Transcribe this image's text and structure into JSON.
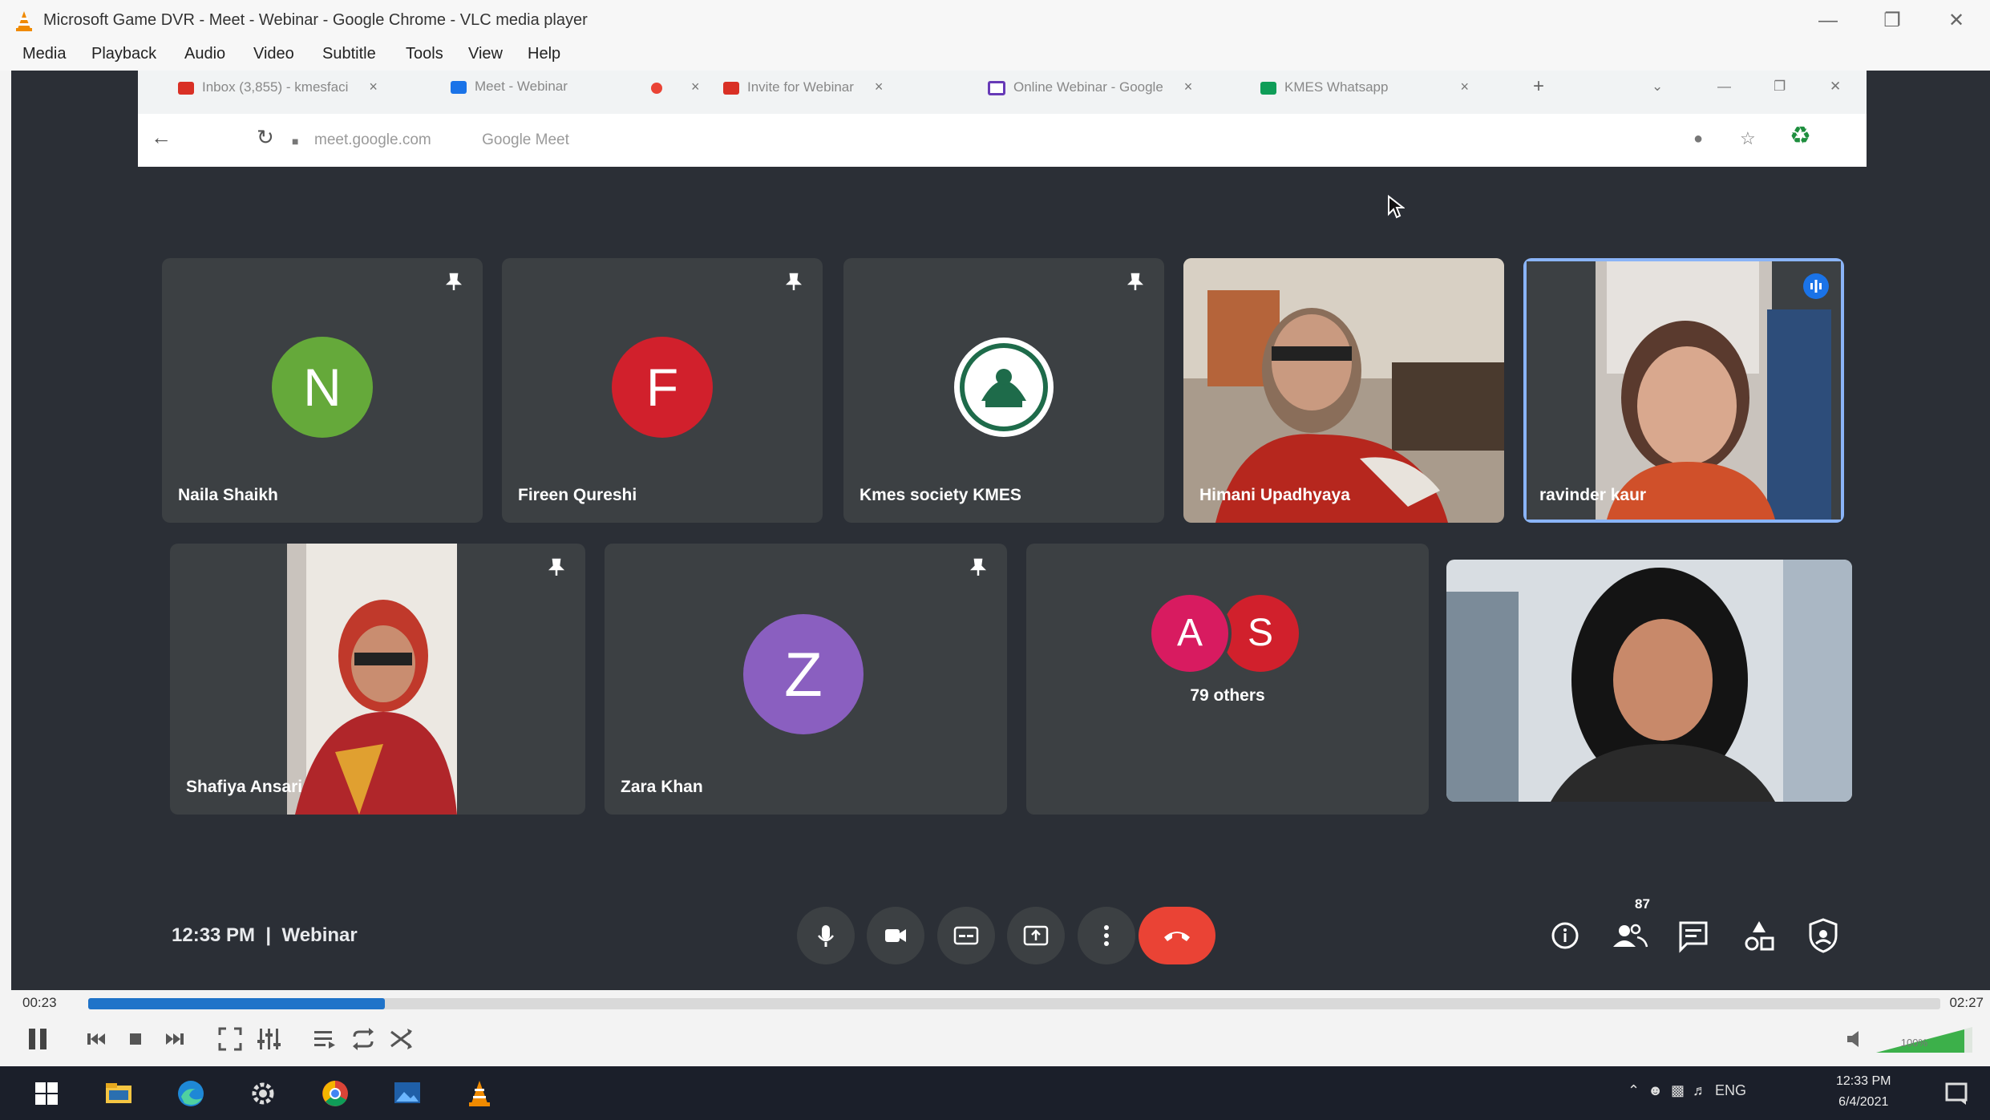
{
  "vlc": {
    "title": "Microsoft Game DVR - Meet - Webinar - Google Chrome - VLC media player",
    "menu": [
      "Media",
      "Playback",
      "Audio",
      "Video",
      "Subtitle",
      "Tools",
      "View",
      "Help"
    ],
    "time_elapsed": "00:23",
    "time_total": "02:27",
    "progress_fraction": 0.16,
    "volume_label": "100%",
    "accent_color": "#1f73c9"
  },
  "chrome": {
    "tabs": [
      {
        "label": "Inbox (3,855) - kmesfaci",
        "icon": "gmail-icon",
        "color": "#d93025"
      },
      {
        "label": "Meet - Webinar",
        "icon": "meet-icon",
        "color": "#1a73e8"
      },
      {
        "label": "",
        "icon": "record-icon",
        "color": "#ea4335"
      },
      {
        "label": "Invite for Webinar",
        "icon": "gmail-icon",
        "color": "#d93025"
      },
      {
        "label": "Online Webinar - Google",
        "icon": "forms-icon",
        "color": "#673ab7"
      },
      {
        "label": "KMES Whatsapp",
        "icon": "sheets-icon",
        "color": "#0f9d58"
      }
    ],
    "url": "meet.google.com",
    "url_suffix": "Google Meet"
  },
  "meet": {
    "participants": [
      {
        "name": "Naila Shaikh",
        "initial": "N",
        "color": "#65a93a",
        "pinned": true,
        "type": "avatar"
      },
      {
        "name": "Fireen Qureshi",
        "initial": "F",
        "color": "#d1202c",
        "pinned": true,
        "type": "avatar"
      },
      {
        "name": "Kmes society KMES",
        "initial": "",
        "color": "#1e6b4a",
        "pinned": true,
        "type": "logo"
      },
      {
        "name": "Himani Upadhyaya",
        "initial": "",
        "color": "",
        "pinned": false,
        "type": "video"
      },
      {
        "name": "ravinder kaur",
        "initial": "",
        "color": "",
        "pinned": false,
        "type": "video",
        "speaking": true
      },
      {
        "name": "Shafiya Ansari",
        "initial": "",
        "color": "",
        "pinned": true,
        "type": "video"
      },
      {
        "name": "Zara Khan",
        "initial": "Z",
        "color": "#8a5fc0",
        "pinned": true,
        "type": "avatar"
      },
      {
        "name": "",
        "initial": "",
        "color": "",
        "pinned": false,
        "type": "video"
      }
    ],
    "others": {
      "label": "79 others",
      "initials": [
        "A",
        "S"
      ],
      "colors": [
        "#d81b60",
        "#d1202c"
      ]
    },
    "time": "12:33 PM",
    "separator": "|",
    "meeting_name": "Webinar",
    "people_count": "87",
    "controls": [
      "mic-icon",
      "camera-icon",
      "captions-icon",
      "present-icon",
      "more-icon"
    ],
    "right_icons": [
      "info-icon",
      "people-icon",
      "chat-icon",
      "activities-icon",
      "host-controls-icon"
    ],
    "hangup_color": "#ea4335"
  },
  "taskbar": {
    "clock_time": "12:33 PM",
    "clock_date": "6/4/2021",
    "tray_lang": "ENG"
  }
}
